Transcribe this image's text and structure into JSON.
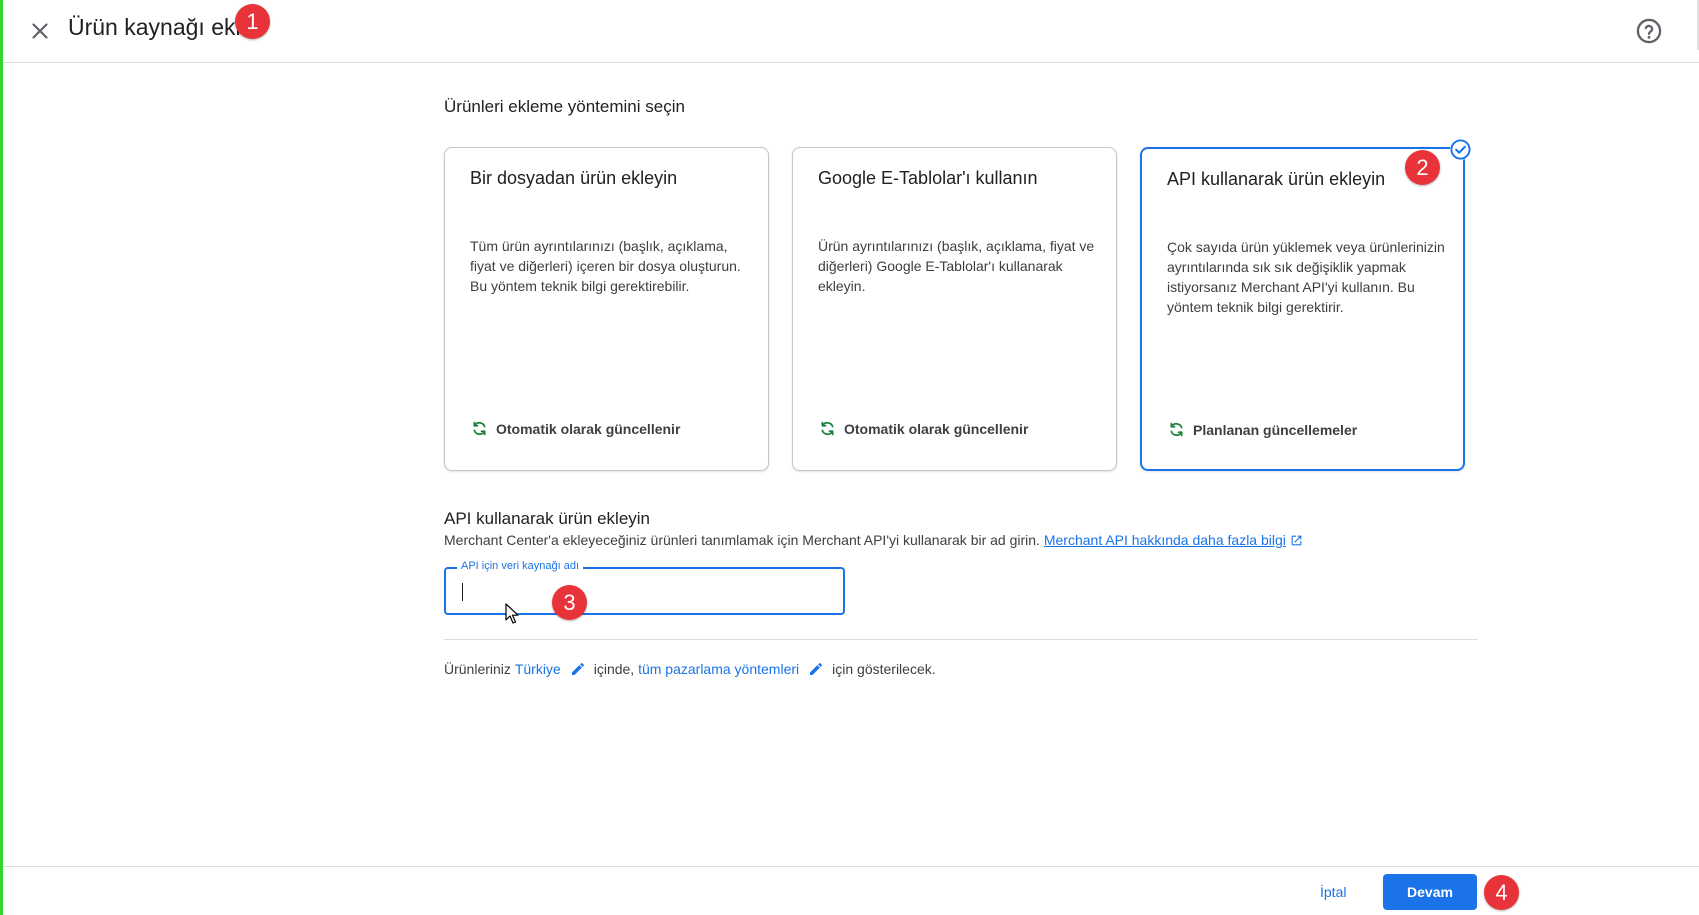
{
  "header": {
    "title": "Ürün kaynağı ekle",
    "close_icon": "close-icon",
    "help_icon": "help-circle-icon"
  },
  "annotations": [
    "1",
    "2",
    "3",
    "4"
  ],
  "section_label": "Ürünleri ekleme yöntemini seçin",
  "cards": [
    {
      "title": "Bir dosyadan ürün ekleyin",
      "description": "Tüm ürün ayrıntılarınızı (başlık, açıklama, fiyat ve diğerleri) içeren bir dosya oluşturun. Bu yöntem teknik bilgi gerektirebilir.",
      "footer": "Otomatik olarak güncellenir",
      "selected": false
    },
    {
      "title": "Google E-Tablolar'ı kullanın",
      "description": "Ürün ayrıntılarınızı (başlık, açıklama, fiyat ve diğerleri) Google E-Tablolar'ı kullanarak ekleyin.",
      "footer": "Otomatik olarak güncellenir",
      "selected": false
    },
    {
      "title": "API kullanarak ürün ekleyin",
      "description": "Çok sayıda ürün yüklemek veya ürünlerinizin ayrıntılarında sık sık değişiklik yapmak istiyorsanız Merchant API'yi kullanın. Bu yöntem teknik bilgi gerektirir.",
      "footer": "Planlanan güncellemeler",
      "selected": true
    }
  ],
  "api_section": {
    "heading": "API kullanarak ürün ekleyin",
    "description": "Merchant Center'a ekleyeceğiniz ürünleri tanımlamak için Merchant API'yi kullanarak bir ad girin.",
    "link": "Merchant API hakkında daha fazla bilgi",
    "field_label": "API için veri kaynağı adı",
    "field_value": ""
  },
  "market": {
    "prefix": "Ürünleriniz",
    "country": "Türkiye",
    "middle": "içinde,",
    "methods": "tüm pazarlama yöntemleri",
    "suffix": "için gösterilecek."
  },
  "footer": {
    "cancel": "İptal",
    "continue": "Devam"
  },
  "colors": {
    "accent": "#1a73e8",
    "badge": "#e8333a",
    "sync_icon": "#188038"
  }
}
